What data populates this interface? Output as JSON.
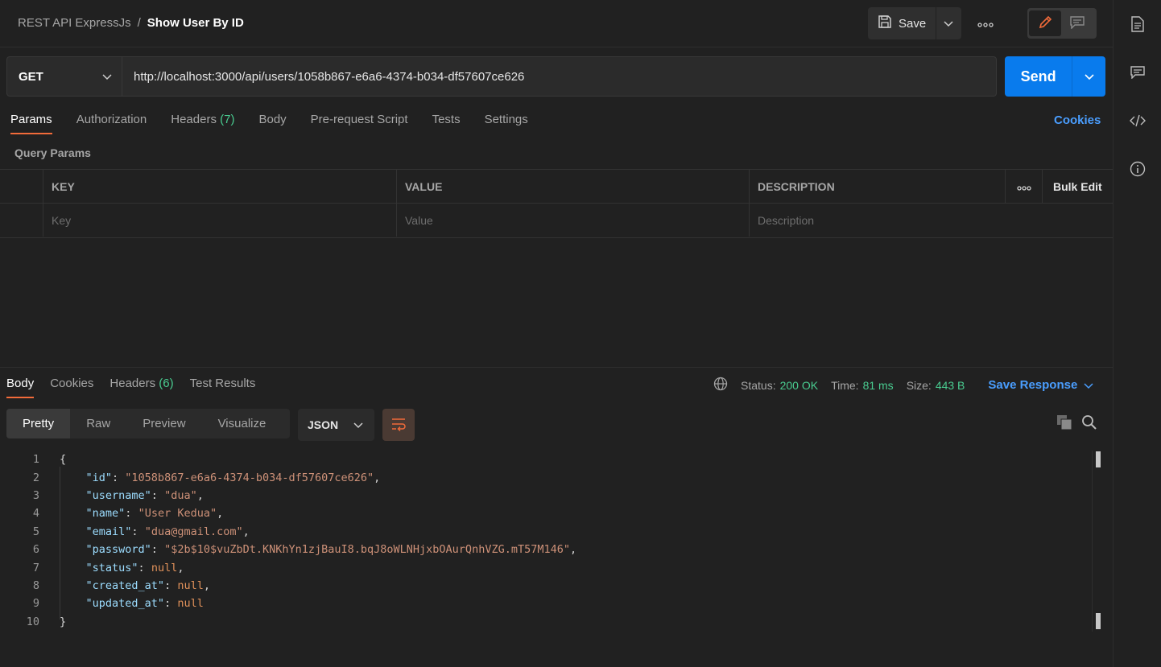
{
  "breadcrumb": {
    "collection": "REST API ExpressJs",
    "separator": "/",
    "request": "Show User By ID"
  },
  "toolbar": {
    "save_label": "Save"
  },
  "request": {
    "method": "GET",
    "url": "http://localhost:3000/api/users/1058b867-e6a6-4374-b034-df57607ce626",
    "send_label": "Send"
  },
  "req_tabs": [
    {
      "label": "Params",
      "count": ""
    },
    {
      "label": "Authorization",
      "count": ""
    },
    {
      "label": "Headers",
      "count": "(7)"
    },
    {
      "label": "Body",
      "count": ""
    },
    {
      "label": "Pre-request Script",
      "count": ""
    },
    {
      "label": "Tests",
      "count": ""
    },
    {
      "label": "Settings",
      "count": ""
    }
  ],
  "cookies_link": "Cookies",
  "query_params": {
    "title": "Query Params",
    "headers": {
      "key": "KEY",
      "value": "VALUE",
      "description": "DESCRIPTION",
      "bulk_edit": "Bulk Edit"
    },
    "placeholders": {
      "key": "Key",
      "value": "Value",
      "description": "Description"
    }
  },
  "response": {
    "tabs": [
      {
        "label": "Body",
        "count": ""
      },
      {
        "label": "Cookies",
        "count": ""
      },
      {
        "label": "Headers",
        "count": "(6)"
      },
      {
        "label": "Test Results",
        "count": ""
      }
    ],
    "status_label": "Status:",
    "status": "200 OK",
    "time_label": "Time:",
    "time": "81 ms",
    "size_label": "Size:",
    "size": "443 B",
    "save_response": "Save Response",
    "views": [
      "Pretty",
      "Raw",
      "Preview",
      "Visualize"
    ],
    "format": "JSON",
    "code_lines": [
      [
        [
          "p",
          "{"
        ]
      ],
      [
        [
          "p",
          "    "
        ],
        [
          "k",
          "\"id\""
        ],
        [
          "p",
          ": "
        ],
        [
          "s",
          "\"1058b867-e6a6-4374-b034-df57607ce626\""
        ],
        [
          "p",
          ","
        ]
      ],
      [
        [
          "p",
          "    "
        ],
        [
          "k",
          "\"username\""
        ],
        [
          "p",
          ": "
        ],
        [
          "s",
          "\"dua\""
        ],
        [
          "p",
          ","
        ]
      ],
      [
        [
          "p",
          "    "
        ],
        [
          "k",
          "\"name\""
        ],
        [
          "p",
          ": "
        ],
        [
          "s",
          "\"User Kedua\""
        ],
        [
          "p",
          ","
        ]
      ],
      [
        [
          "p",
          "    "
        ],
        [
          "k",
          "\"email\""
        ],
        [
          "p",
          ": "
        ],
        [
          "s",
          "\"dua@gmail.com\""
        ],
        [
          "p",
          ","
        ]
      ],
      [
        [
          "p",
          "    "
        ],
        [
          "k",
          "\"password\""
        ],
        [
          "p",
          ": "
        ],
        [
          "s",
          "\"$2b$10$vuZbDt.KNKhYn1zjBauI8.bqJ8oWLNHjxbOAurQnhVZG.mT57M146\""
        ],
        [
          "p",
          ","
        ]
      ],
      [
        [
          "p",
          "    "
        ],
        [
          "k",
          "\"status\""
        ],
        [
          "p",
          ": "
        ],
        [
          "n",
          "null"
        ],
        [
          "p",
          ","
        ]
      ],
      [
        [
          "p",
          "    "
        ],
        [
          "k",
          "\"created_at\""
        ],
        [
          "p",
          ": "
        ],
        [
          "n",
          "null"
        ],
        [
          "p",
          ","
        ]
      ],
      [
        [
          "p",
          "    "
        ],
        [
          "k",
          "\"updated_at\""
        ],
        [
          "p",
          ": "
        ],
        [
          "n",
          "null"
        ]
      ],
      [
        [
          "p",
          "}"
        ]
      ]
    ]
  },
  "colors": {
    "accent": "#f26b3a",
    "send": "#097bed",
    "status_green": "#49cc90",
    "link_blue": "#4a9eff"
  },
  "icons": [
    "save-icon",
    "chevron-down-icon",
    "more-icon",
    "pencil-icon",
    "comment-icon",
    "document-icon",
    "code-icon",
    "info-icon",
    "globe-icon",
    "wrap-icon",
    "copy-icon",
    "search-icon"
  ]
}
